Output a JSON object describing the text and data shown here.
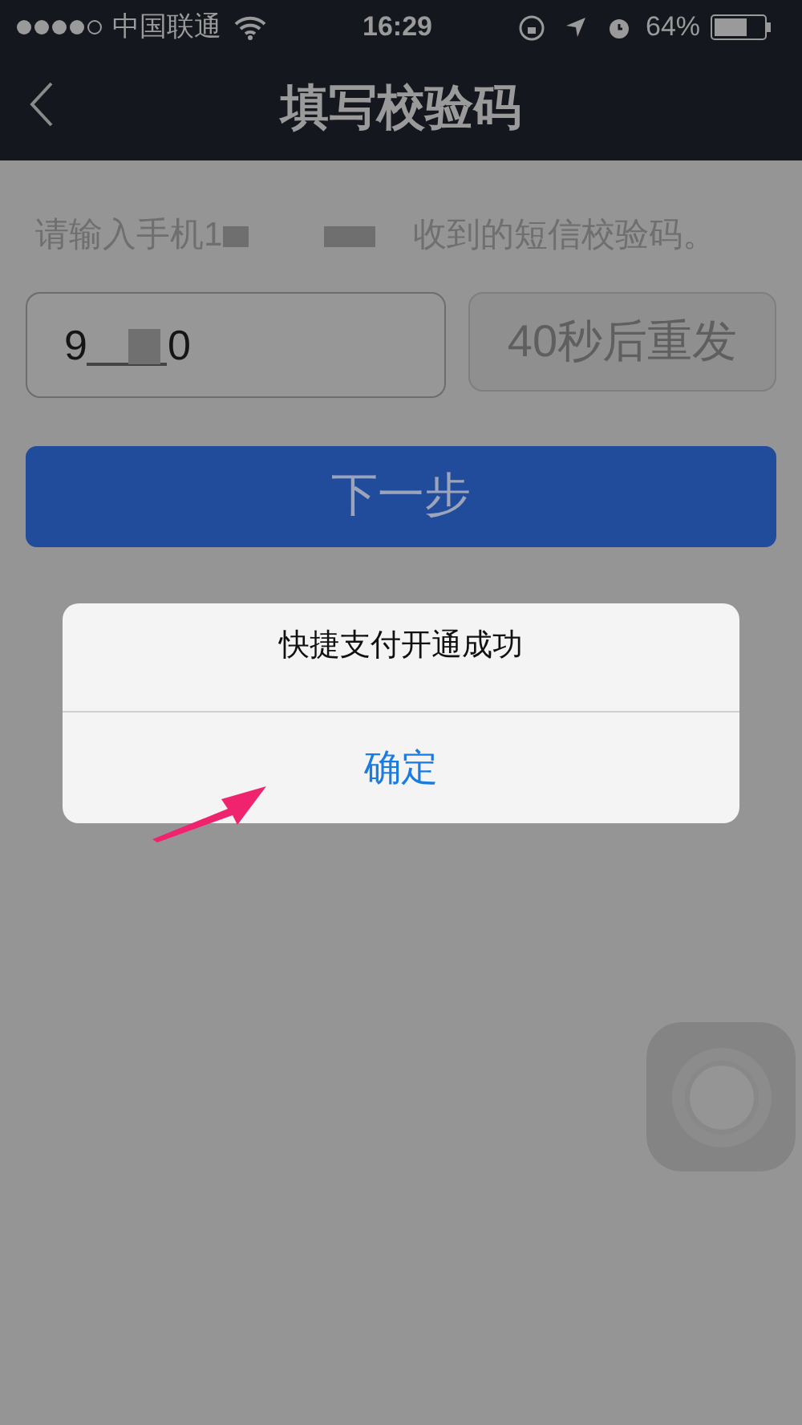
{
  "status_bar": {
    "carrier": "中国联通",
    "time": "16:29",
    "battery": "64%"
  },
  "nav": {
    "title": "填写校验码"
  },
  "instruction": {
    "before": "请输入手机1",
    "after": "收到的短信校验码。"
  },
  "code_field": {
    "value_start": "9",
    "value_end": "0"
  },
  "resend_button": {
    "label": "40秒后重发",
    "disabled": true
  },
  "next_button": {
    "label": "下一步"
  },
  "alert": {
    "message": "快捷支付开通成功",
    "button": "确定"
  }
}
